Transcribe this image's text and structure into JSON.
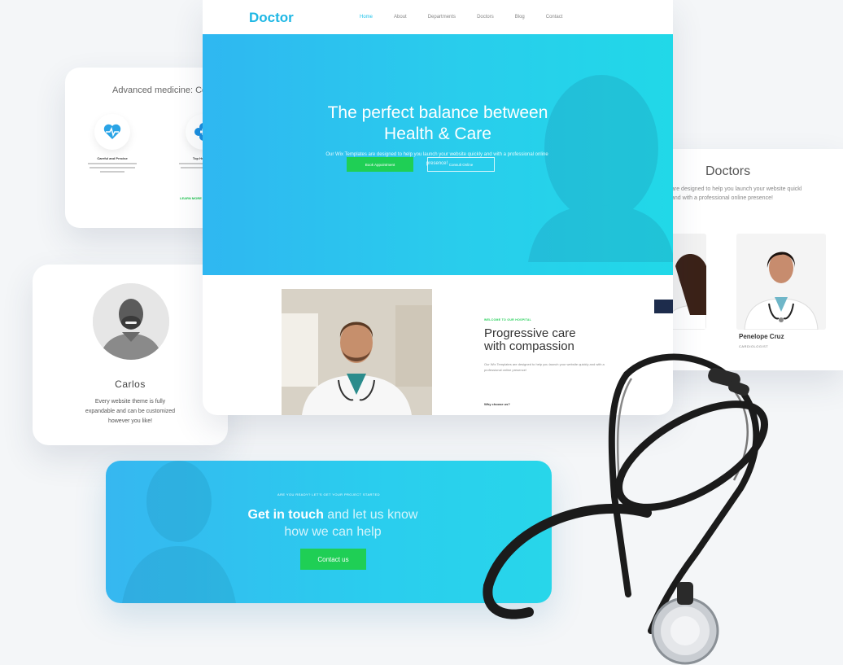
{
  "medicine_card": {
    "heading": "Advanced medicine: Co",
    "features": [
      {
        "title": "Careful and Precise",
        "icon": "heart-pulse-icon"
      },
      {
        "title": "Top Hospitals",
        "icon": "medical-cross-icon"
      }
    ],
    "link": "LEARN MORE"
  },
  "profile_card": {
    "name": "Carlos",
    "bio": "Every website theme is fully expandable and can be customized however you like!"
  },
  "doctors_card": {
    "title": "Doctors",
    "subtitle_line1": "are designed to help you launch your website quickl",
    "subtitle_line2": "and with a professional online presence!",
    "doctor_name": "Penelope Cruz",
    "doctor_role": "CARDIOLOGIST"
  },
  "site": {
    "logo": "Doctor",
    "nav": [
      "Home",
      "About",
      "Departments",
      "Doctors",
      "Blog",
      "Contact"
    ],
    "active_nav": "Home",
    "hero_title_line1": "The perfect balance between",
    "hero_title_line2": "Health & Care",
    "hero_text": "Our Wix Templates are designed to help you launch your website quickly and with a professional online presence!",
    "book_button": "Book Appointment",
    "consult_button": "Consult Online",
    "care_eyebrow": "WELCOME TO OUR HOSPITAL",
    "care_title_line1": "Progressive care",
    "care_title_line2": "with compassion",
    "care_text": "Our Wix Templates are designed to help you launch your website quickly and with a professional online presence!",
    "why_label": "Why choose us?"
  },
  "contact_banner": {
    "eyebrow": "ARE YOU READY? LET'S GET YOUR PROJECT STARTED",
    "title_bold": "Get in touch",
    "title_rest": " and let us know",
    "title_line2": "how we can help",
    "button": "Contact us"
  },
  "colors": {
    "brand_blue": "#29c4ee",
    "green": "#1fcf55",
    "navy": "#1d2c4c"
  }
}
